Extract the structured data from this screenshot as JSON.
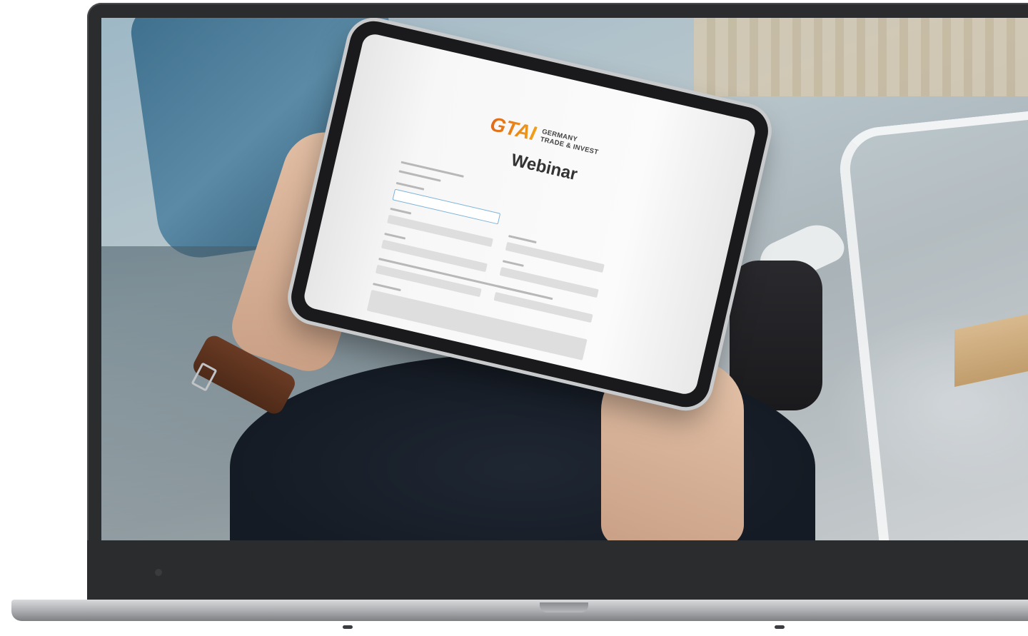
{
  "image": {
    "subject": "laptop-mockup",
    "tablet_screen": {
      "logo_mark": "GTAI",
      "logo_line_1": "GERMANY",
      "logo_line_2": "TRADE & INVEST",
      "heading": "Webinar"
    },
    "colors": {
      "laptop_body": "#2b2c2e",
      "logo_orange": "#e06a1a",
      "logo_yellow": "#f0a01a",
      "tablet_bezel": "#1a1a1c"
    }
  }
}
